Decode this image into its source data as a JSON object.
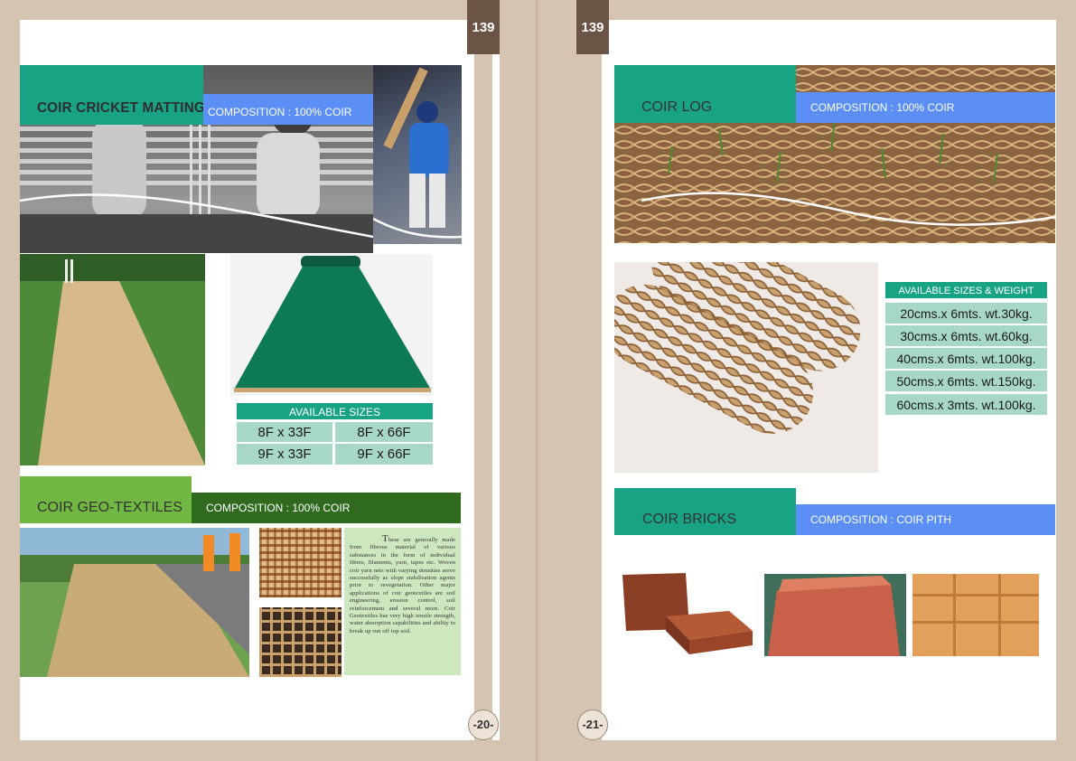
{
  "page_tab_left": "139",
  "page_tab_right": "139",
  "footer": {
    "left": "-20-",
    "right": "-21-"
  },
  "left_page": {
    "cricket": {
      "title": "COIR CRICKET MATTING",
      "composition": "COMPOSITION : 100% COIR",
      "sizes_title": "AVAILABLE SIZES",
      "sizes": [
        [
          "8F x 33F",
          "8F x 66F"
        ],
        [
          "9F x 33F",
          "9F x 66F"
        ]
      ]
    },
    "geo": {
      "title": "COIR GEO-TEXTILES",
      "composition": "COMPOSITION : 100% COIR",
      "drop_cap": "T",
      "description": "hese are generally made from fibrous material of various substances in the form of individual fibres, filaments, yarn, tapes etc. Woven coir yarn nets with varying densities serve successfully as slope stabilisation agents prior to revegetation. Other major applications of coir geotextiles are soil engineering, erosion control, soil reinforcement and several more. Coir Geotextiles has very high tensile strength, water absorption capabilities and ability to break up run off top soil."
    }
  },
  "right_page": {
    "log": {
      "title": "COIR LOG",
      "composition": "COMPOSITION : 100% COIR",
      "sizes_title": "AVAILABLE SIZES & WEIGHT",
      "sizes": [
        "20cms.x 6mts. wt.30kg.",
        "30cms.x 6mts. wt.60kg.",
        "40cms.x 6mts. wt.100kg.",
        "50cms.x 6mts. wt.150kg.",
        "60cms.x 3mts. wt.100kg."
      ]
    },
    "bricks": {
      "title": "COIR BRICKS",
      "composition": "COMPOSITION : COIR PITH"
    }
  },
  "colors": {
    "teal": "#19a385",
    "blue": "#5b8ff5",
    "green": "#71b843",
    "dark_green": "#2f6a1f",
    "brown": "#6b5445",
    "light_teal": "#a7d7c7"
  }
}
